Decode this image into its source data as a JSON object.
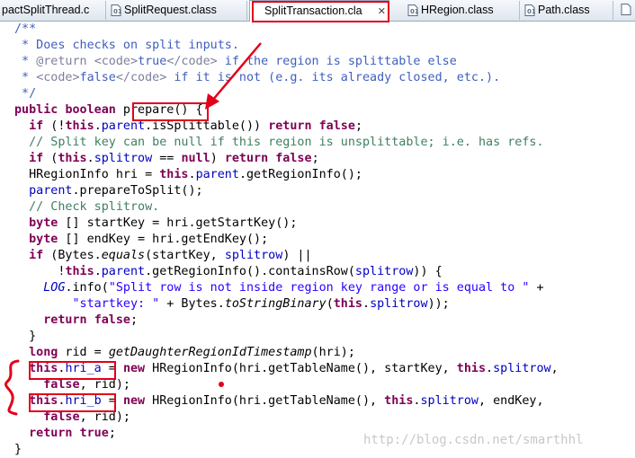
{
  "tabs": [
    {
      "label": "pactSplitThread.c",
      "active": false,
      "icon": "c-source-file-icon"
    },
    {
      "label": "SplitRequest.class",
      "active": false,
      "icon": "java-class-file-icon"
    },
    {
      "label": "SplitTransaction.cla",
      "active": true,
      "icon": "java-class-file-icon",
      "close_glyph": "✕"
    },
    {
      "label": "HRegion.class",
      "active": false,
      "icon": "java-class-file-icon"
    },
    {
      "label": "Path.class",
      "active": false,
      "icon": "java-class-file-icon"
    }
  ],
  "code_lines": [
    "/**",
    " * Does checks on split inputs.",
    " * @return <code>true</code> if the region is splittable else",
    " * <code>false</code> if it is not (e.g. its already closed, etc.).",
    " */",
    "public boolean prepare() {",
    "  if (!this.parent.isSplittable()) return false;",
    "  // Split key can be null if this region is unsplittable; i.e. has refs.",
    "  if (this.splitrow == null) return false;",
    "  HRegionInfo hri = this.parent.getRegionInfo();",
    "  parent.prepareToSplit();",
    "  // Check splitrow.",
    "  byte [] startKey = hri.getStartKey();",
    "  byte [] endKey = hri.getEndKey();",
    "  if (Bytes.equals(startKey, splitrow) ||",
    "      !this.parent.getRegionInfo().containsRow(splitrow)) {",
    "    LOG.info(\"Split row is not inside region key range or is equal to \" +",
    "        \"startkey: \" + Bytes.toStringBinary(this.splitrow));",
    "    return false;",
    "  }",
    "  long rid = getDaughterRegionIdTimestamp(hri);",
    "  this.hri_a = new HRegionInfo(hri.getTableName(), startKey, this.splitrow,",
    "    false, rid);",
    "  this.hri_b = new HRegionInfo(hri.getTableName(), this.splitrow, endKey,",
    "    false, rid);",
    "  return true;",
    "}"
  ],
  "watermark": "http://blog.csdn.net/smarthhl",
  "colors": {
    "keyword": "#7f0055",
    "comment": "#3f7f5f",
    "javadoc": "#3f5fbf",
    "field": "#0000c0",
    "string": "#2a00ff",
    "annotation": "#e2001a"
  }
}
